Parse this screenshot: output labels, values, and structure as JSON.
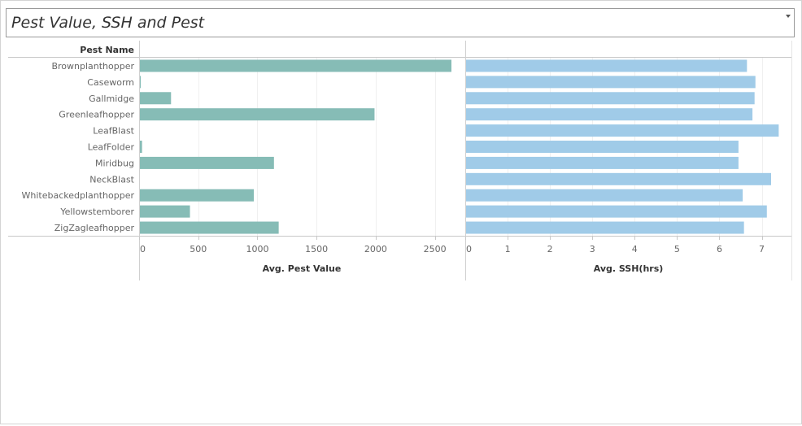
{
  "title": "Pest Value, SSH and Pest",
  "row_header": "Pest Name",
  "colors": {
    "pest_bar": "#86bcb6",
    "ssh_bar": "#a0cbe8"
  },
  "chart_data": [
    {
      "type": "bar",
      "orientation": "horizontal",
      "categories": [
        "Brownplanthopper",
        "Caseworm",
        "Gallmidge",
        "Greenleafhopper",
        "LeafBlast",
        "LeafFolder",
        "Miridbug",
        "NeckBlast",
        "Whitebackedplanthopper",
        "Yellowstemborer",
        "ZigZagleafhopper"
      ],
      "values": [
        2640,
        5,
        270,
        1990,
        0,
        25,
        1140,
        0,
        970,
        430,
        1180
      ],
      "xlabel": "Avg. Pest Value",
      "xlim": [
        0,
        2750
      ],
      "ticks": [
        0,
        500,
        1000,
        1500,
        2000,
        2500
      ],
      "grid": true
    },
    {
      "type": "bar",
      "orientation": "horizontal",
      "categories": [
        "Brownplanthopper",
        "Caseworm",
        "Gallmidge",
        "Greenleafhopper",
        "LeafBlast",
        "LeafFolder",
        "Miridbug",
        "NeckBlast",
        "Whitebackedplanthopper",
        "Yellowstemborer",
        "ZigZagleafhopper"
      ],
      "values": [
        6.65,
        6.85,
        6.83,
        6.78,
        7.4,
        6.45,
        6.45,
        7.22,
        6.55,
        7.12,
        6.58
      ],
      "xlabel": "Avg. SSH(hrs)",
      "xlim": [
        0,
        7.7
      ],
      "ticks": [
        0,
        1,
        2,
        3,
        4,
        5,
        6,
        7
      ],
      "grid": true
    }
  ]
}
